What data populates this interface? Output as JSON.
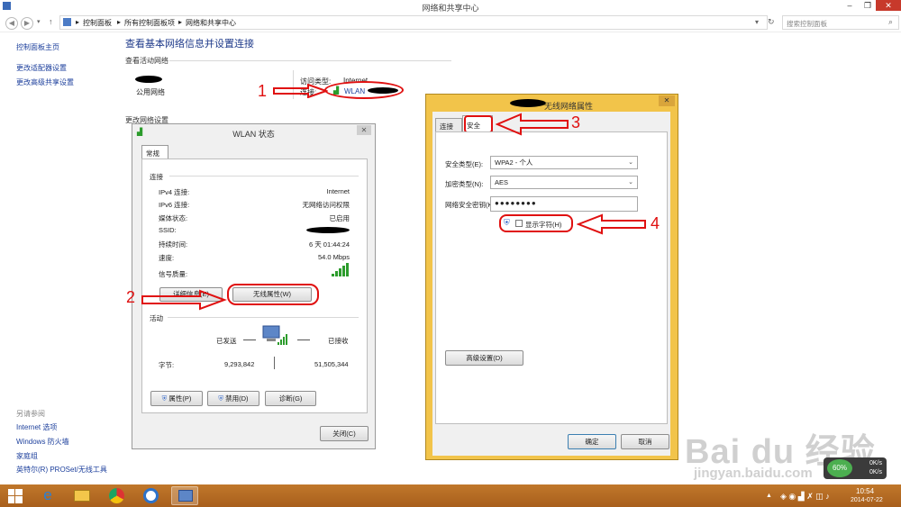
{
  "window": {
    "title": "网络和共享中心",
    "controls": [
      "–",
      "❐",
      "✕"
    ]
  },
  "address": {
    "crumbs": [
      "控制面板",
      "所有控制面板项",
      "网络和共享中心"
    ],
    "search_placeholder": "搜索控制面板"
  },
  "sidebar": {
    "links": [
      "控制面板主页",
      "更改适配器设置",
      "更改高级共享设置"
    ],
    "see_also_title": "另请参阅",
    "see_also": [
      "Internet 选项",
      "Windows 防火墙",
      "家庭组",
      "英特尔(R) PROSet/无线工具"
    ]
  },
  "main": {
    "heading": "查看基本网络信息并设置连接",
    "active_networks": "查看活动网络",
    "network_type": "公用网络",
    "access_type_label": "访问类型:",
    "access_type_value": "Internet",
    "connection_label": "连接:",
    "connection_value": "WLAN",
    "change_settings": "更改网络设置"
  },
  "status_dialog": {
    "title": "WLAN 状态",
    "tab": "常规",
    "connection_section": "连接",
    "rows": [
      {
        "label": "IPv4 连接:",
        "value": "Internet"
      },
      {
        "label": "IPv6 连接:",
        "value": "无网络访问权限"
      },
      {
        "label": "媒体状态:",
        "value": "已启用"
      },
      {
        "label": "SSID:",
        "value": ""
      },
      {
        "label": "持续时间:",
        "value": "6 天 01:44:24"
      },
      {
        "label": "速度:",
        "value": "54.0 Mbps"
      }
    ],
    "signal_label": "信号质量:",
    "details_button": "详细信息(E)",
    "wireless_props_button": "无线属性(W)",
    "activity_section": "活动",
    "sent_label": "已发送",
    "received_label": "已接收",
    "bytes_label": "字节:",
    "bytes_sent": "9,293,842",
    "bytes_received": "51,505,344",
    "properties_button": "属性(P)",
    "disable_button": "禁用(D)",
    "diagnose_button": "诊断(G)",
    "close_button": "关闭(C)"
  },
  "props_dialog": {
    "title": "无线网络属性",
    "tabs": [
      "连接",
      "安全"
    ],
    "security_type_label": "安全类型(E):",
    "security_type_value": "WPA2 - 个人",
    "encryption_label": "加密类型(N):",
    "encryption_value": "AES",
    "key_label": "网络安全密钥(K)",
    "key_value": "●●●●●●●●",
    "show_chars_label": "显示字符(H)",
    "advanced_button": "高级设置(D)",
    "ok_button": "确定",
    "cancel_button": "取消"
  },
  "annotations": {
    "n1": "1",
    "n2": "2",
    "n3": "3",
    "n4": "4",
    "color": "#e01010"
  },
  "taskbar": {
    "time": "10:54",
    "date": "2014-07-22",
    "battery": "60%",
    "net_up": "0K/s",
    "net_down": "0K/s"
  },
  "watermark": {
    "logo": "Bai du 经验",
    "url": "jingyan.baidu.com"
  }
}
